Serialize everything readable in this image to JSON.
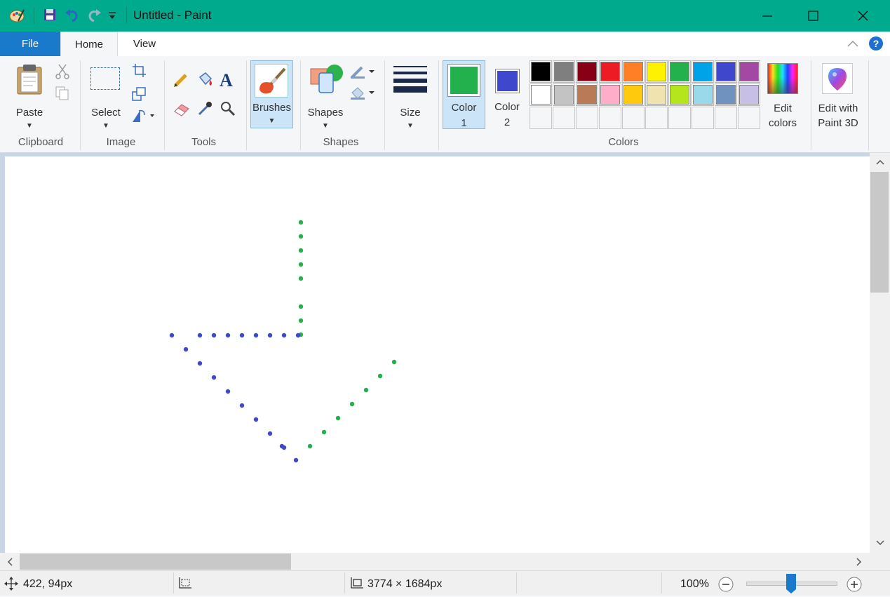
{
  "window": {
    "title": "Untitled - Paint"
  },
  "quick_access": {
    "icons": [
      "paint-app-icon",
      "save-icon",
      "undo-icon",
      "redo-icon",
      "customize-qat-icon"
    ]
  },
  "tabs": [
    {
      "label": "File"
    },
    {
      "label": "Home"
    },
    {
      "label": "View"
    }
  ],
  "ribbon": {
    "clipboard": {
      "paste_label": "Paste",
      "group_label": "Clipboard"
    },
    "image": {
      "select_label": "Select",
      "group_label": "Image"
    },
    "tools": {
      "group_label": "Tools"
    },
    "brushes": {
      "label": "Brushes"
    },
    "shapes": {
      "label": "Shapes",
      "group_label": "Shapes"
    },
    "size": {
      "label": "Size"
    },
    "colors": {
      "color1_label": "Color",
      "color1_num": "1",
      "color2_label": "Color",
      "color2_num": "2",
      "color1": "#22b14c",
      "color2": "#3f48cc",
      "palette_row1": [
        "#000000",
        "#7f7f7f",
        "#880015",
        "#ed1c24",
        "#ff7f27",
        "#fff200",
        "#22b14c",
        "#00a2e8",
        "#3f48cc",
        "#a349a4"
      ],
      "palette_row2": [
        "#ffffff",
        "#c3c3c3",
        "#b97a57",
        "#ffaec9",
        "#ffc90e",
        "#efe4b0",
        "#b5e61d",
        "#99d9ea",
        "#7092be",
        "#c8bfe7"
      ],
      "edit_line1": "Edit",
      "edit_line2": "colors",
      "group_label": "Colors"
    },
    "paint3d": {
      "line1": "Edit with",
      "line2": "Paint 3D"
    }
  },
  "status": {
    "cursor_pos": "422, 94px",
    "image_size": "3774 × 1684px",
    "zoom": "100%",
    "zoom_level": 1.0
  }
}
